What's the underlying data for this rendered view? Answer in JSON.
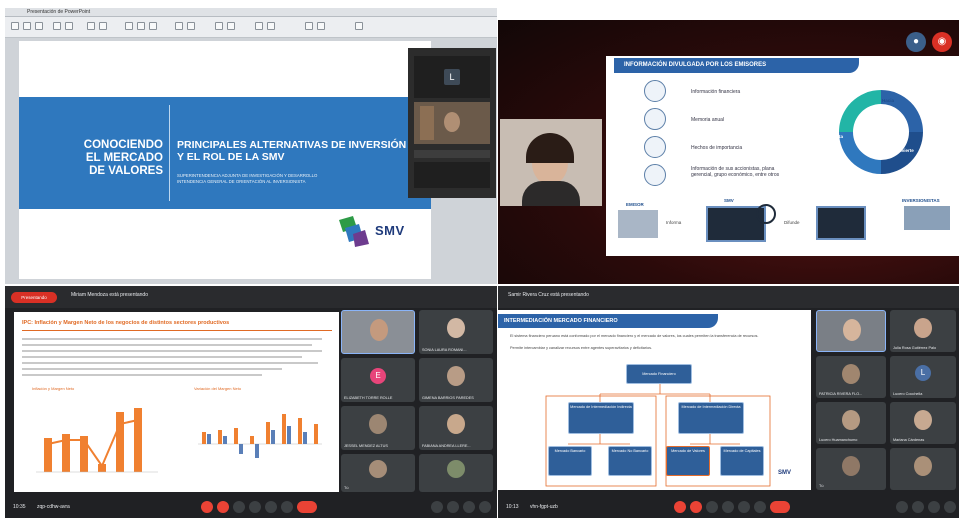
{
  "panel1": {
    "window_title": "Presentación de PowerPoint",
    "slide": {
      "left_title_lines": [
        "CONOCIENDO",
        "EL MERCADO",
        "DE VALORES"
      ],
      "right_title_lines": [
        "PRINCIPALES ALTERNATIVAS DE INVERSIÓN",
        "Y EL ROL DE LA SMV"
      ],
      "subtitle_lines": [
        "SUPERINTENDENCIA ADJUNTA DE INVESTIGACIÓN Y DESARROLLO",
        "INTENDENCIA GENERAL DE ORIENTACIÓN AL INVERSIONISTA"
      ],
      "logo_text": "SMV",
      "logo_small": "Superintendencia del Mercado de Valores"
    },
    "side_avatar_letter": "L"
  },
  "panel2": {
    "slide": {
      "header": "INFORMACIÓN DIVULGADA POR LOS EMISORES",
      "items": [
        "Información financiera",
        "Memoria anual",
        "Hechos de importancia",
        "Información de sus accionistas, plana gerencial, grupo económico, entre otros"
      ],
      "cycle_labels": [
        "Hacia",
        "Reporta",
        "Reinvierte"
      ],
      "bottom_labels": [
        "EMISOR",
        "Informa",
        "SMV",
        "Difunde",
        "INVERSIONISTAS"
      ]
    }
  },
  "panel3": {
    "presenting_pill": "Presentando",
    "presenting_text": "Miriam Mendoza está presentando",
    "slide": {
      "title": "IPC: Inflación y Margen Neto de los negocios de distintos sectores productivos",
      "chart_left_title": "Inflación y Margen Neto",
      "chart_right_title": "Variación del Margen Neto"
    },
    "tiles": [
      {
        "name": "",
        "avatar": ""
      },
      {
        "name": "SONIA LAURA ROMANI...",
        "avatar": ""
      },
      {
        "name": "ELIZABETH TORRE ROLLE",
        "avatar": "E"
      },
      {
        "name": "GIMENA BARRIOS PAREDES",
        "avatar": ""
      },
      {
        "name": "JESSEL MENDEZ ALTUS",
        "avatar": ""
      },
      {
        "name": "FABIANA ANDREA LLERE...",
        "avatar": ""
      },
      {
        "name": "Tú",
        "avatar": ""
      },
      {
        "name": "",
        "avatar": ""
      }
    ],
    "bottom_time": "10:35",
    "meeting_code": "zqp-cdhw-avra"
  },
  "panel4": {
    "presenting_text": "Samir Rivera Cruz está presentando",
    "slide": {
      "header": "INTERMEDIACIÓN MERCADO FINANCIERO",
      "paragraphs": [
        "El sistema financiero peruano está conformado por el mercado financiero y el mercado de valores, los cuales permiten la transferencia de recursos.",
        "Permite intercambiar y canalizar recursos entre agentes superavitarios y deficitarios."
      ],
      "root_node": "Mercado Financiero",
      "mid_nodes": [
        "Mercado de Intermediación Indirecta",
        "Mercado de Intermediación Directa"
      ],
      "leaf_nodes": [
        "Mercado Bancario",
        "Mercado No Bancario",
        "Mercado de Valores",
        "Mercado de Capitales"
      ],
      "logo_text": "SMV"
    },
    "tiles": [
      {
        "name": "",
        "avatar": ""
      },
      {
        "name": "Julia Rosa Gutiérrez Palo",
        "avatar": ""
      },
      {
        "name": "PATRICIA RIVERA FLO...",
        "avatar": ""
      },
      {
        "name": "Lucero Cocchella",
        "avatar": "L"
      },
      {
        "name": "Lucero Huamanchumo",
        "avatar": ""
      },
      {
        "name": "Mariana Cárdenas",
        "avatar": ""
      },
      {
        "name": "Tú",
        "avatar": ""
      },
      {
        "name": "",
        "avatar": ""
      }
    ],
    "bottom_time": "10:13",
    "meeting_code": "vhn-fgpt-uzb"
  }
}
